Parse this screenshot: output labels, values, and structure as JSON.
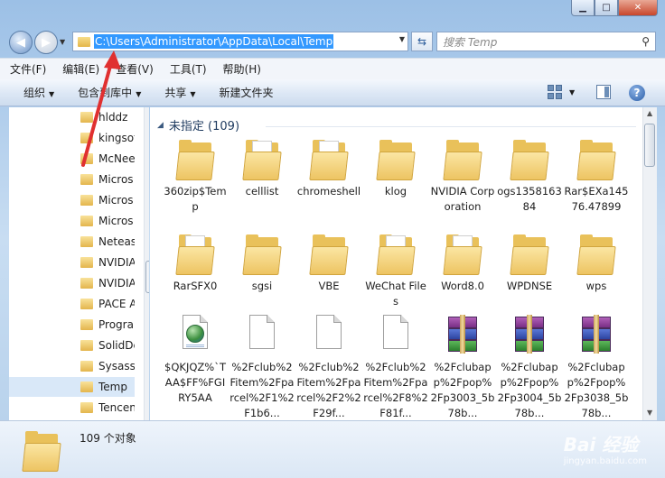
{
  "window": {
    "minimize": "▁",
    "maximize": "□",
    "close": "✕"
  },
  "address_bar": {
    "path": "C:\\Users\\Administrator\\AppData\\Local\\Temp"
  },
  "search": {
    "placeholder": "搜索 Temp"
  },
  "menu": {
    "items": [
      "文件(F)",
      "编辑(E)",
      "查看(V)",
      "工具(T)",
      "帮助(H)"
    ]
  },
  "toolbar": {
    "organize": "组织",
    "include_in_library": "包含到库中",
    "share": "共享",
    "new_folder": "新建文件夹",
    "help": "?"
  },
  "nav_pane": {
    "items": [
      "hlddz",
      "kingsoft",
      "McNee",
      "Micros",
      "Micros",
      "Micros",
      "Neteas",
      "NVIDIA",
      "NVIDIA",
      "PACE A",
      "Progra",
      "SolidDe",
      "Sysassi",
      "Temp",
      "Tencen"
    ],
    "selected_index": 13
  },
  "content": {
    "group_header": "未指定 (109)",
    "items": [
      {
        "name": "360zip$Temp",
        "type": "folder"
      },
      {
        "name": "celllist",
        "type": "folder-paper"
      },
      {
        "name": "chromeshell",
        "type": "folder-paper"
      },
      {
        "name": "klog",
        "type": "folder"
      },
      {
        "name": "NVIDIA Corporation",
        "type": "folder"
      },
      {
        "name": "ogs135816384",
        "type": "folder"
      },
      {
        "name": "Rar$EXa14576.47899",
        "type": "folder"
      },
      {
        "name": "RarSFX0",
        "type": "folder-paper"
      },
      {
        "name": "sgsi",
        "type": "folder"
      },
      {
        "name": "VBE",
        "type": "folder"
      },
      {
        "name": "WeChat Files",
        "type": "folder-paper"
      },
      {
        "name": "Word8.0",
        "type": "folder-paper"
      },
      {
        "name": "WPDNSE",
        "type": "folder"
      },
      {
        "name": "wps",
        "type": "folder"
      },
      {
        "name": "$QKJQZ%`TAA$FF%FGIRY5AA",
        "type": "html"
      },
      {
        "name": "%2Fclub%2Fitem%2Fparcel%2F1%2F1b6...",
        "type": "file"
      },
      {
        "name": "%2Fclub%2Fitem%2Fparcel%2F2%2F29f...",
        "type": "file"
      },
      {
        "name": "%2Fclub%2Fitem%2Fparcel%2F8%2F81f...",
        "type": "file"
      },
      {
        "name": "%2Fclubapp%2Fpop%2Fp3003_5b78b...",
        "type": "rar"
      },
      {
        "name": "%2Fclubapp%2Fpop%2Fp3004_5b78b...",
        "type": "rar"
      },
      {
        "name": "%2Fclubapp%2Fpop%2Fp3038_5b78b...",
        "type": "rar"
      }
    ]
  },
  "status": {
    "text": "109 个对象"
  },
  "watermark": {
    "brand": "Bai 经验",
    "url": "jingyan.baidu.com"
  },
  "colors": {
    "selection": "#3399ff",
    "annotation_arrow": "#e03030",
    "folder": "#e9c15a"
  }
}
